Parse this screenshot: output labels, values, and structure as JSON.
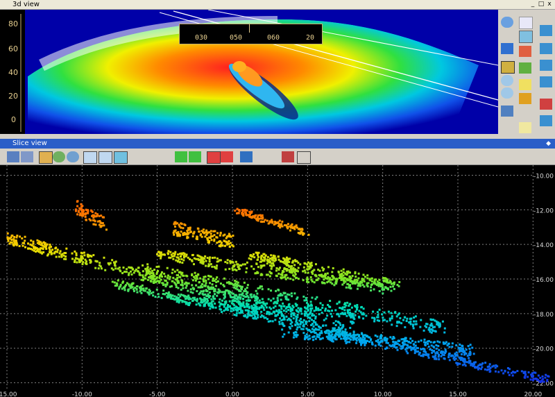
{
  "top_panel": {
    "title": "3d view",
    "buttons": [
      "_",
      "□",
      "x"
    ]
  },
  "view3d": {
    "depth_scale": [
      "80",
      "60",
      "40",
      "20",
      "0"
    ],
    "compass": {
      "headings": [
        "030",
        "050",
        "060",
        "20"
      ]
    },
    "right_toolbar": [
      "rotate-icon",
      "points-icon",
      "grid-icon",
      "arrow-down-icon",
      "dots-icon",
      "color-ramp-icon",
      "fit-view-icon",
      "zoom-in-icon",
      "zoom-out-icon",
      "light-icon",
      "texture-icon",
      "crosshair-icon",
      "info-icon"
    ]
  },
  "slice_panel": {
    "title": "Slice view",
    "button": "◆"
  },
  "slice_toolbar": [
    "globe-icon",
    "save-icon",
    "fit-icon",
    "zoom-in-icon",
    "zoom-out-icon",
    "measure-icon",
    "crosshair-icon",
    "grid-icon",
    "flag-green-icon",
    "flag-green2-icon",
    "flag-red-icon",
    "flag-red2-icon",
    "pin-icon",
    "properties-icon",
    "pointer-icon"
  ],
  "chart_data": {
    "type": "scatter",
    "x_ticks": [
      "-15.00",
      "-10.00",
      "-5.00",
      "0.00",
      "5.00",
      "10.00",
      "15.00",
      "20.00"
    ],
    "y_ticks": [
      "-10.00",
      "-12.00",
      "-14.00",
      "-16.00",
      "-18.00",
      "-20.00",
      "-22.00"
    ],
    "xlim": [
      -15,
      21
    ],
    "ylim": [
      -22.5,
      -9.5
    ],
    "grid": true,
    "color_scale": "depth (orange shallow → blue deep)"
  }
}
